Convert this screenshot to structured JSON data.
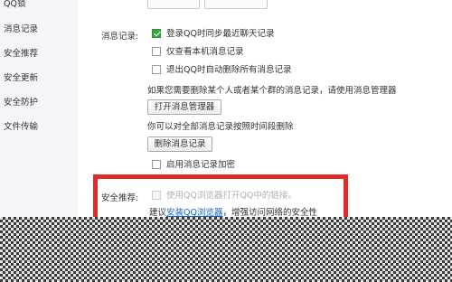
{
  "sidebar": {
    "items": [
      {
        "label": "QQ锁"
      },
      {
        "label": "消息记录"
      },
      {
        "label": "安全推荐"
      },
      {
        "label": "安全更新"
      },
      {
        "label": "安全防护"
      },
      {
        "label": "文件传输"
      }
    ]
  },
  "message_record": {
    "section_label": "消息记录:",
    "sync_checkbox": {
      "label": "登录QQ时同步最近聊天记录",
      "checked": true
    },
    "local_checkbox": {
      "label": "仅查看本机消息记录",
      "checked": false
    },
    "delete_on_exit_checkbox": {
      "label": "退出QQ时自动删除所有消息记录",
      "checked": false
    },
    "manager_hint": "如果您需要删除某个人或者某个群的消息记录，请使用消息管理器",
    "open_manager_button": "打开消息管理器",
    "delete_hint": "你可以对全部消息记录按照时间段删除",
    "delete_records_button": "删除消息记录",
    "encrypt_checkbox": {
      "label": "启用消息记录加密",
      "checked": false
    }
  },
  "security_recommend": {
    "section_label": "安全推荐:",
    "browser_checkbox": {
      "label": "使用QQ浏览器打开QQ中的链接。",
      "checked": false,
      "disabled": true
    },
    "suggest_prefix": "建议",
    "install_link": "安装QQ浏览器",
    "suggest_suffix": "，增强访问网络的安全性"
  },
  "colors": {
    "highlight_box": "#e02a2a",
    "check_green": "#3aa842",
    "link_blue": "#1a63c5"
  }
}
